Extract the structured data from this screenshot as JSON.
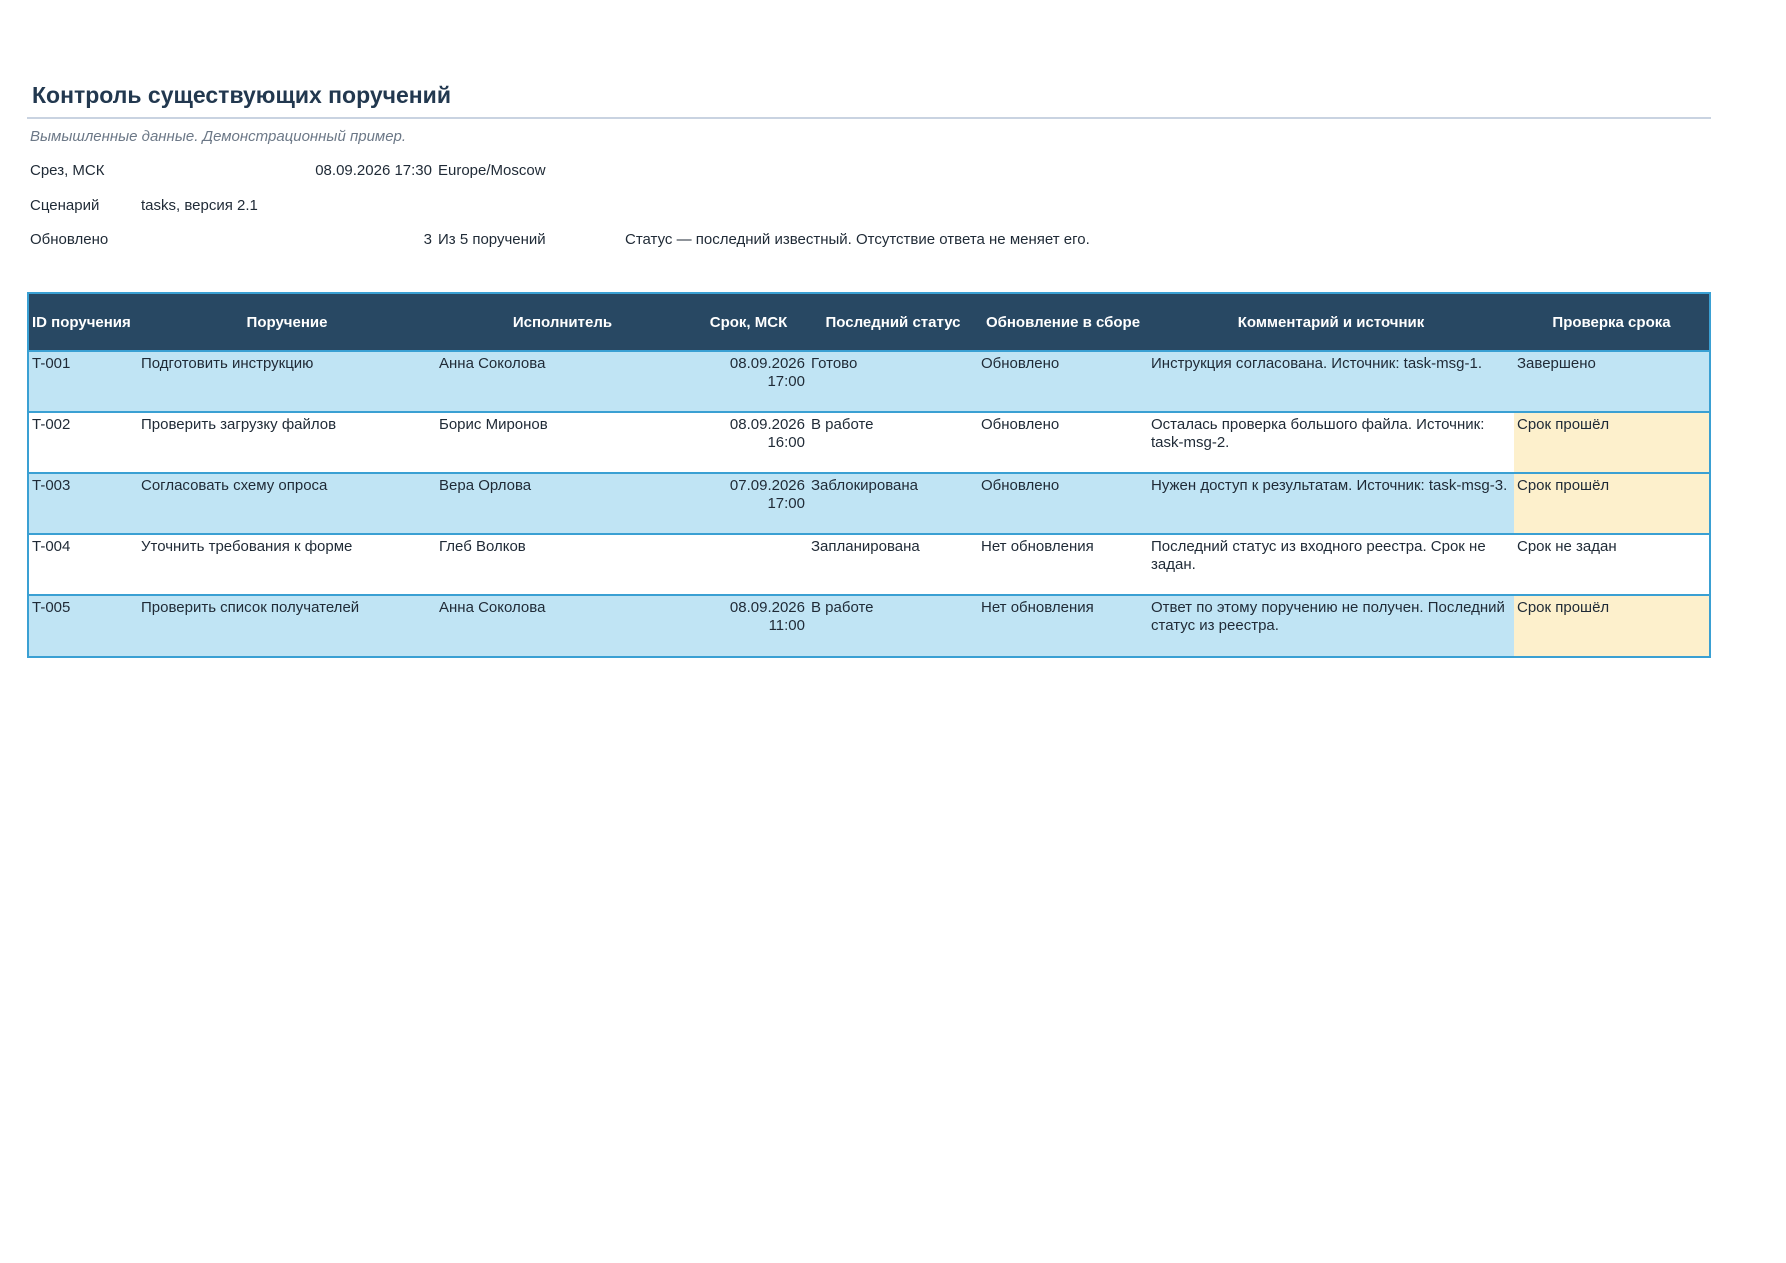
{
  "page": {
    "title": "Контроль существующих поручений",
    "subtitle": "Вымышленные данные. Демонстрационный пример."
  },
  "meta": {
    "snapshot_label": "Срез, МСК",
    "snapshot_value": "08.09.2026 17:30",
    "snapshot_tz": "Europe/Moscow",
    "scenario_label": "Сценарий",
    "scenario_value": "tasks, версия 2.1",
    "updated_label": "Обновлено",
    "updated_count": "3",
    "updated_of": "Из 5 поручений",
    "updated_note": "Статус — последний известный. Отсутствие ответа не меняет его."
  },
  "table": {
    "headers": [
      "ID поручения",
      "Поручение",
      "Исполнитель",
      "Срок, МСК",
      "Последний статус",
      "Обновление в сборе",
      "Комментарий и источник",
      "Проверка срока"
    ],
    "rows": [
      {
        "id": "T-001",
        "task": "Подготовить инструкцию",
        "assignee": "Анна Соколова",
        "deadline": "08.09.2026 17:00",
        "status": "Готово",
        "update": "Обновлено",
        "comment": "Инструкция согласована. Источник: task-msg-1.",
        "check": "Завершено",
        "check_highlight": false
      },
      {
        "id": "T-002",
        "task": "Проверить загрузку файлов",
        "assignee": "Борис Миронов",
        "deadline": "08.09.2026 16:00",
        "status": "В работе",
        "update": "Обновлено",
        "comment": "Осталась проверка большого файла. Источник: task-msg-2.",
        "check": "Срок прошёл",
        "check_highlight": true
      },
      {
        "id": "T-003",
        "task": "Согласовать схему опроса",
        "assignee": "Вера Орлова",
        "deadline": "07.09.2026 17:00",
        "status": "Заблокирована",
        "update": "Обновлено",
        "comment": "Нужен доступ к результатам. Источник: task-msg-3.",
        "check": "Срок прошёл",
        "check_highlight": true
      },
      {
        "id": "T-004",
        "task": "Уточнить требования к форме",
        "assignee": "Глеб Волков",
        "deadline": "",
        "status": "Запланирована",
        "update": "Нет обновления",
        "comment": "Последний статус из входного реестра. Срок не задан.",
        "check": "Срок не задан",
        "check_highlight": false
      },
      {
        "id": "T-005",
        "task": "Проверить список получателей",
        "assignee": "Анна Соколова",
        "deadline": "08.09.2026 11:00",
        "status": "В работе",
        "update": "Нет обновления",
        "comment": "Ответ по этому поручению не получен. Последний статус из реестра.",
        "check": "Срок прошёл",
        "check_highlight": true
      }
    ]
  }
}
